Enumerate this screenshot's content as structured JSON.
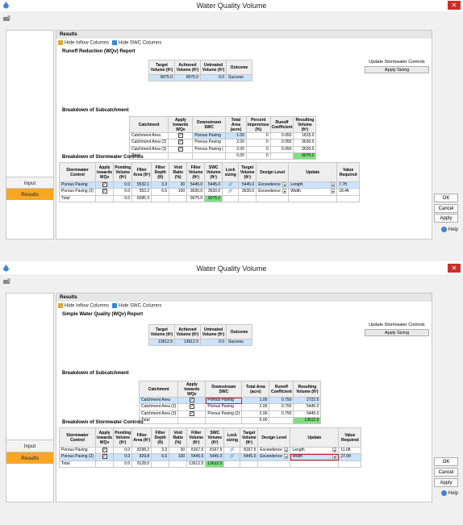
{
  "windows": [
    {
      "title": "Water Quality Volume",
      "nav": {
        "input": "Input",
        "results": "Results"
      },
      "header": "Results",
      "toolbar": {
        "hide_inflow": "Hide Inflow Columns",
        "hide_swc": "Hide SWC Columns"
      },
      "report_title": "Runoff Reduction (WQv) Report",
      "update_label": "Update Stormwater Controls",
      "apply_sizing": "Apply Sizing",
      "summary": {
        "headers": [
          "Target Volume (ft³)",
          "Achieved Volume (ft³)",
          "Untreated Volume (ft³)",
          "Outcome"
        ],
        "row": [
          "9075.0",
          "9075.0",
          "0.0",
          "Success"
        ]
      },
      "subcatch_title": "Breakdown of Subcatchment",
      "subcatch": {
        "headers": [
          "Catchment",
          "Apply towards WQv",
          "Downstream SWC",
          "Total Area (acre)",
          "Percent Impervious (%)",
          "Runoff Coefficient",
          "Resulting Volume (ft³)"
        ],
        "rows": [
          [
            "Catchment Area",
            "✓",
            "Porous Paving",
            "1.00",
            "0",
            "0.050",
            "1815.0"
          ],
          [
            "Catchment Area (2)",
            "✓",
            "Porous Paving",
            "2.00",
            "0",
            "0.050",
            "3630.0"
          ],
          [
            "Catchment Area (3)",
            "✓",
            "Porous Paving (",
            "2.00",
            "0",
            "0.050",
            "3630.0"
          ],
          [
            "Total",
            "",
            "",
            "5.00",
            "0",
            "",
            "9075.0"
          ]
        ]
      },
      "swc_title": "Breakdown of Stormwater Controls",
      "swc": {
        "headers": [
          "Stormwater Control",
          "Apply towards WQv",
          "Ponding Volume (ft³)",
          "Filter Area (ft²)",
          "Filter Depth (ft)",
          "Void Ratio (%)",
          "Filter Volume (ft³)",
          "SWC Volume (ft³)",
          "Lock sizing",
          "Target Volume (ft³)",
          "Design Level",
          "Update",
          "Value Required"
        ],
        "rows": [
          [
            "Porous Paving",
            "✓",
            "0.0",
            "5532.1",
            "3.3",
            "30",
            "5445.0",
            "5445.0",
            "🔗",
            "5445.0",
            "Exceedence",
            "Length",
            "7.7ft"
          ],
          [
            "Porous Paving (2)",
            "✓",
            "0.0",
            "553.2",
            "6.6",
            "100",
            "3630.0",
            "3630.0",
            "🔗",
            "3630.0",
            "Exceedence",
            "Width",
            "18.4ft"
          ],
          [
            "Total",
            "",
            "0.0",
            "6085.3",
            "",
            "",
            "9075.0",
            "9075.0",
            "",
            "",
            "",
            "",
            ""
          ]
        ]
      },
      "buttons": {
        "ok": "OK",
        "cancel": "Cancel",
        "apply": "Apply",
        "help": "Help"
      }
    },
    {
      "title": "Water Quality Volume",
      "nav": {
        "input": "Input",
        "results": "Results"
      },
      "header": "Results",
      "toolbar": {
        "hide_inflow": "Hide Inflow Columns",
        "hide_swc": "Hide SWC Columns"
      },
      "report_title": "Simple Water Quality (WQv) Report",
      "update_label": "Update Stormwater Controls",
      "apply_sizing": "Apply Sizing",
      "summary": {
        "headers": [
          "Target Volume (ft³)",
          "Achieved Volume (ft³)",
          "Untreated Volume (ft³)",
          "Outcome"
        ],
        "row": [
          "13612.5",
          "13612.5",
          "0.0",
          "Success"
        ]
      },
      "subcatch_title": "Breakdown of Subcatchment",
      "subcatch": {
        "headers": [
          "Catchment",
          "Apply towards WQv",
          "Downstream SWC",
          "Total Area (acre)",
          "Runoff Coefficient",
          "Resulting Volume (ft³)"
        ],
        "rows": [
          [
            "Catchment Area",
            "✓",
            "Porous Paving",
            "1.00",
            "0.750",
            "2722.5"
          ],
          [
            "Catchment Area (2)",
            "✓",
            "Porous Paving",
            "2.00",
            "0.750",
            "5445.0"
          ],
          [
            "Catchment Area (3)",
            "✓",
            "Porous Paving (2)",
            "2.00",
            "0.750",
            "5445.0"
          ],
          [
            "Total",
            "",
            "",
            "5.00",
            "",
            "13612.5"
          ]
        ]
      },
      "swc_title": "Breakdown of Stormwater Controls",
      "swc": {
        "headers": [
          "Stormwater Control",
          "Apply towards WQv",
          "Ponding Volume (ft³)",
          "Filter Area (ft²)",
          "Filter Depth (ft)",
          "Void Ratio (%)",
          "Filter Volume (ft³)",
          "SWC Volume (ft³)",
          "Lock sizing",
          "Target Volume (ft³)",
          "Design Level",
          "Update",
          "Value Required"
        ],
        "rows": [
          [
            "Porous Paving",
            "✓",
            "0.0",
            "8298.2",
            "3.3",
            "30",
            "8167.5",
            "8167.5",
            "🔗",
            "8167.5",
            "Exceedence",
            "Length",
            "11.6ft"
          ],
          [
            "Porous Paving (2)",
            "✓",
            "0.0",
            "829.8",
            "6.6",
            "100",
            "5445.0",
            "5445.0",
            "🔗",
            "5445.0",
            "Exceedence",
            "Width",
            "27.6ft"
          ],
          [
            "Total",
            "",
            "0.0",
            "9128.0",
            "",
            "",
            "13612.5",
            "13612.5",
            "",
            "",
            "",
            "",
            ""
          ]
        ]
      },
      "buttons": {
        "ok": "OK",
        "cancel": "Cancel",
        "apply": "Apply",
        "help": "Help"
      }
    }
  ]
}
